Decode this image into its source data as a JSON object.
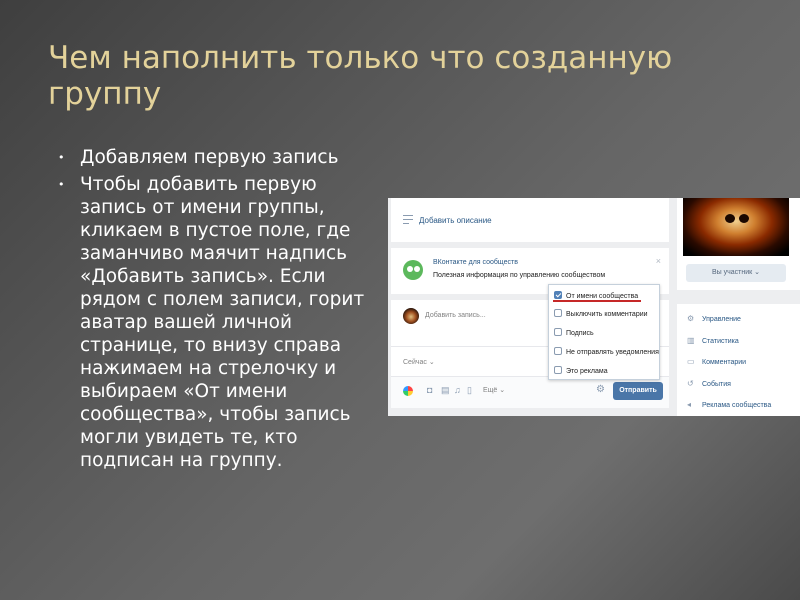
{
  "slide": {
    "title": "Чем наполнить только что созданную группу",
    "bullets": [
      {
        "text": "Добавляем первую запись"
      },
      {
        "text": "Чтобы добавить первую запись от имени группы, кликаем в пустое поле, где заманчиво маячит надпись «Добавить запись». Если рядом с полем записи, горит аватар вашей личной странице, то внизу справа нажимаем на стрелочку и выбираем «От имени сообщества», чтобы запись могли увидеть те, кто подписан на группу."
      }
    ]
  },
  "vk": {
    "description_link": "Добавить описание",
    "promo": {
      "title": "ВКонтакте для сообществ",
      "subtitle": "Полезная информация по управлению сообществом",
      "close": "×"
    },
    "post": {
      "placeholder": "Добавить запись...",
      "sort": "Сейчас ⌄",
      "more": "Ещё ⌄",
      "send_label": "Отправить"
    },
    "post_options": [
      {
        "label": "От имени сообщества",
        "checked": true
      },
      {
        "label": "Выключить комментарии",
        "checked": false
      },
      {
        "label": "Подпись",
        "checked": false
      },
      {
        "label": "Не отправлять уведомления",
        "checked": false
      },
      {
        "label": "Это реклама",
        "checked": false
      }
    ],
    "member_button": "Вы участник ⌄",
    "menu": [
      {
        "icon": "gear-icon",
        "label": "Управление"
      },
      {
        "icon": "statistics-icon",
        "label": "Статистика"
      },
      {
        "icon": "comments-icon",
        "label": "Комментарии"
      },
      {
        "icon": "events-icon",
        "label": "События"
      },
      {
        "icon": "ads-icon",
        "label": "Реклама сообщества"
      }
    ],
    "colors": {
      "accent": "#4a76a8",
      "link": "#2a5885",
      "highlight": "#c62828"
    }
  }
}
